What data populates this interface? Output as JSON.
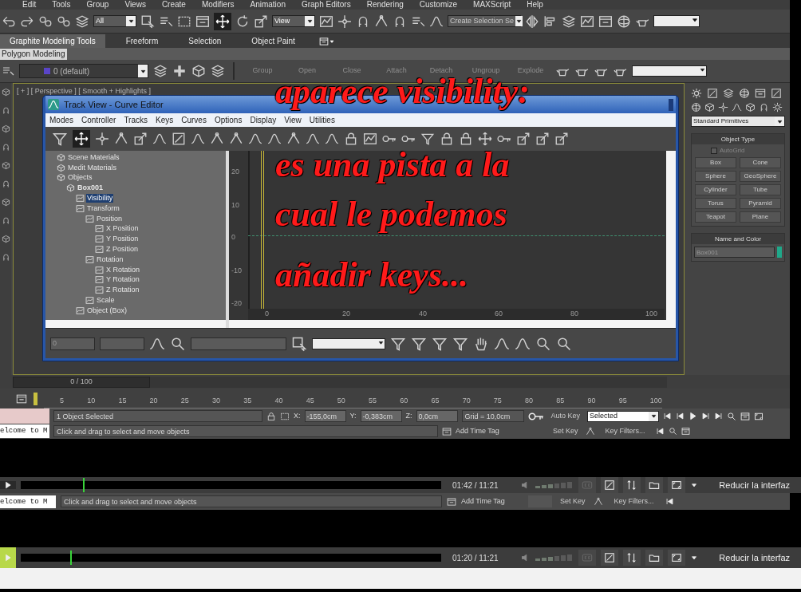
{
  "menu_bar": {
    "items": [
      "Edit",
      "Tools",
      "Group",
      "Views",
      "Create",
      "Modifiers",
      "Animation",
      "Graph Editors",
      "Rendering",
      "Customize",
      "MAXScript",
      "Help"
    ]
  },
  "main_toolbar": {
    "selection_filter": "All",
    "reference_coord": "View",
    "named_selection": "Create Selection Se"
  },
  "ribbon": {
    "tabs": [
      {
        "label": "Graphite Modeling Tools",
        "selected": true
      },
      {
        "label": "Freeform",
        "selected": false
      },
      {
        "label": "Selection",
        "selected": false
      },
      {
        "label": "Object Paint",
        "selected": false
      }
    ],
    "panel": "Polygon Modeling"
  },
  "layer_toolbar": {
    "layer": "0 (default)",
    "buttons": [
      "Group",
      "Open",
      "Close",
      "Attach",
      "Detach",
      "Ungroup",
      "Explode"
    ]
  },
  "viewport": {
    "label": "[ + ] [ Perspective ] [ Smooth + Highlights ]"
  },
  "track_view": {
    "title": "Track View - Curve Editor",
    "menus": [
      "Modes",
      "Controller",
      "Tracks",
      "Keys",
      "Curves",
      "Options",
      "Display",
      "View",
      "Utilities"
    ],
    "tree": [
      {
        "label": "Scene Materials",
        "selected": false
      },
      {
        "label": "Medit Materials",
        "selected": false
      },
      {
        "label": "Objects",
        "selected": false,
        "children": [
          {
            "label": "Box001",
            "selected": false,
            "children": [
              {
                "label": "Visibility",
                "selected": true
              },
              {
                "label": "Transform",
                "selected": false,
                "children": [
                  {
                    "label": "Position",
                    "selected": false,
                    "children": [
                      {
                        "label": "X Position",
                        "selected": false
                      },
                      {
                        "label": "Y Position",
                        "selected": false
                      },
                      {
                        "label": "Z Position",
                        "selected": false
                      }
                    ]
                  },
                  {
                    "label": "Rotation",
                    "selected": false,
                    "children": [
                      {
                        "label": "X Rotation",
                        "selected": false
                      },
                      {
                        "label": "Y Rotation",
                        "selected": false
                      },
                      {
                        "label": "Z Rotation",
                        "selected": false
                      }
                    ]
                  },
                  {
                    "label": "Scale",
                    "selected": false
                  }
                ]
              },
              {
                "label": "Object (Box)",
                "selected": false
              }
            ]
          }
        ]
      }
    ],
    "y_ticks": [
      "20",
      "10",
      "0",
      "-10",
      "-20"
    ],
    "x_ticks": [
      "0",
      "20",
      "40",
      "60",
      "80",
      "100"
    ],
    "frame_field": "0"
  },
  "annotation": [
    "aparece visibility:",
    "es una pista a la",
    "cual le podemos",
    "añadir keys..."
  ],
  "command_panel": {
    "dropdown": "Standard Primitives",
    "object_type": {
      "title": "Object Type",
      "autogrid": {
        "label": "AutoGrid",
        "checked": false
      },
      "buttons": [
        "Box",
        "Cone",
        "Sphere",
        "GeoSphere",
        "Cylinder",
        "Tube",
        "Torus",
        "Pyramid",
        "Teapot",
        "Plane"
      ]
    },
    "name_and_color": {
      "title": "Name and Color",
      "name": "Box001"
    }
  },
  "time_slider": {
    "label": "0 / 100"
  },
  "track_bar": {
    "ticks": [
      "5",
      "10",
      "15",
      "20",
      "25",
      "30",
      "35",
      "40",
      "45",
      "50",
      "55",
      "60",
      "65",
      "70",
      "75",
      "80",
      "85",
      "90",
      "95",
      "100"
    ]
  },
  "status_bar": {
    "prompt_line": "elcome to M",
    "selection": "1 Object Selected",
    "coordinates": [
      {
        "axis": "X:",
        "value": "-155,0cm"
      },
      {
        "axis": "Y:",
        "value": "-0,383cm"
      },
      {
        "axis": "Z:",
        "value": "0,0cm"
      }
    ],
    "grid": "Grid = 10,0cm",
    "auto_key": "Auto Key",
    "key_mode": "Selected",
    "set_key": "Set Key",
    "key_filters": "Key Filters...",
    "hint": "Click and drag to select and move objects",
    "add_time_tag": "Add Time Tag"
  },
  "players": [
    {
      "time": "01:42 / 11:21",
      "level": 0.148,
      "button": "Reducir la interfaz"
    },
    {
      "time": "01:20 / 11:21",
      "level": 0.117,
      "button": "Reducir la interfaz"
    }
  ],
  "ghost_status": {
    "prompt_line": "elcome to M",
    "hint": "Click and drag to select and move objects",
    "add_time_tag": "Add Time Tag",
    "set_key": "Set Key",
    "key_filters": "Key Filters..."
  }
}
